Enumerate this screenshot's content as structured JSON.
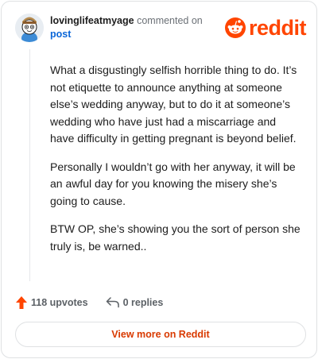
{
  "comment": {
    "username": "lovinglifeatmyage",
    "action_text": "commented on",
    "post_link": "post",
    "paragraphs": [
      "What a disgustingly selfish horrible thing to do. It’s not etiquette to announce anything at someone else’s wedding anyway, but to do it at someone’s wedding who have just had a miscarriage and have difficulty in getting pregnant is beyond belief.",
      "Personally I wouldn’t go with her anyway, it will be an awful day for you knowing the misery she’s going to cause.",
      "BTW OP, she’s showing you the sort of person she truly is, be warned.."
    ]
  },
  "brand": {
    "name": "reddit",
    "icon": "reddit-snoo-icon",
    "color": "#ff4500"
  },
  "actions": {
    "upvotes_label": "118 upvotes",
    "upvote_icon": "upvote-arrow-icon",
    "upvote_color": "#ff4500",
    "replies_label": "0 replies",
    "reply_icon": "reply-icon"
  },
  "footer": {
    "view_more_label": "View more on Reddit",
    "link_color": "#d93a00"
  }
}
